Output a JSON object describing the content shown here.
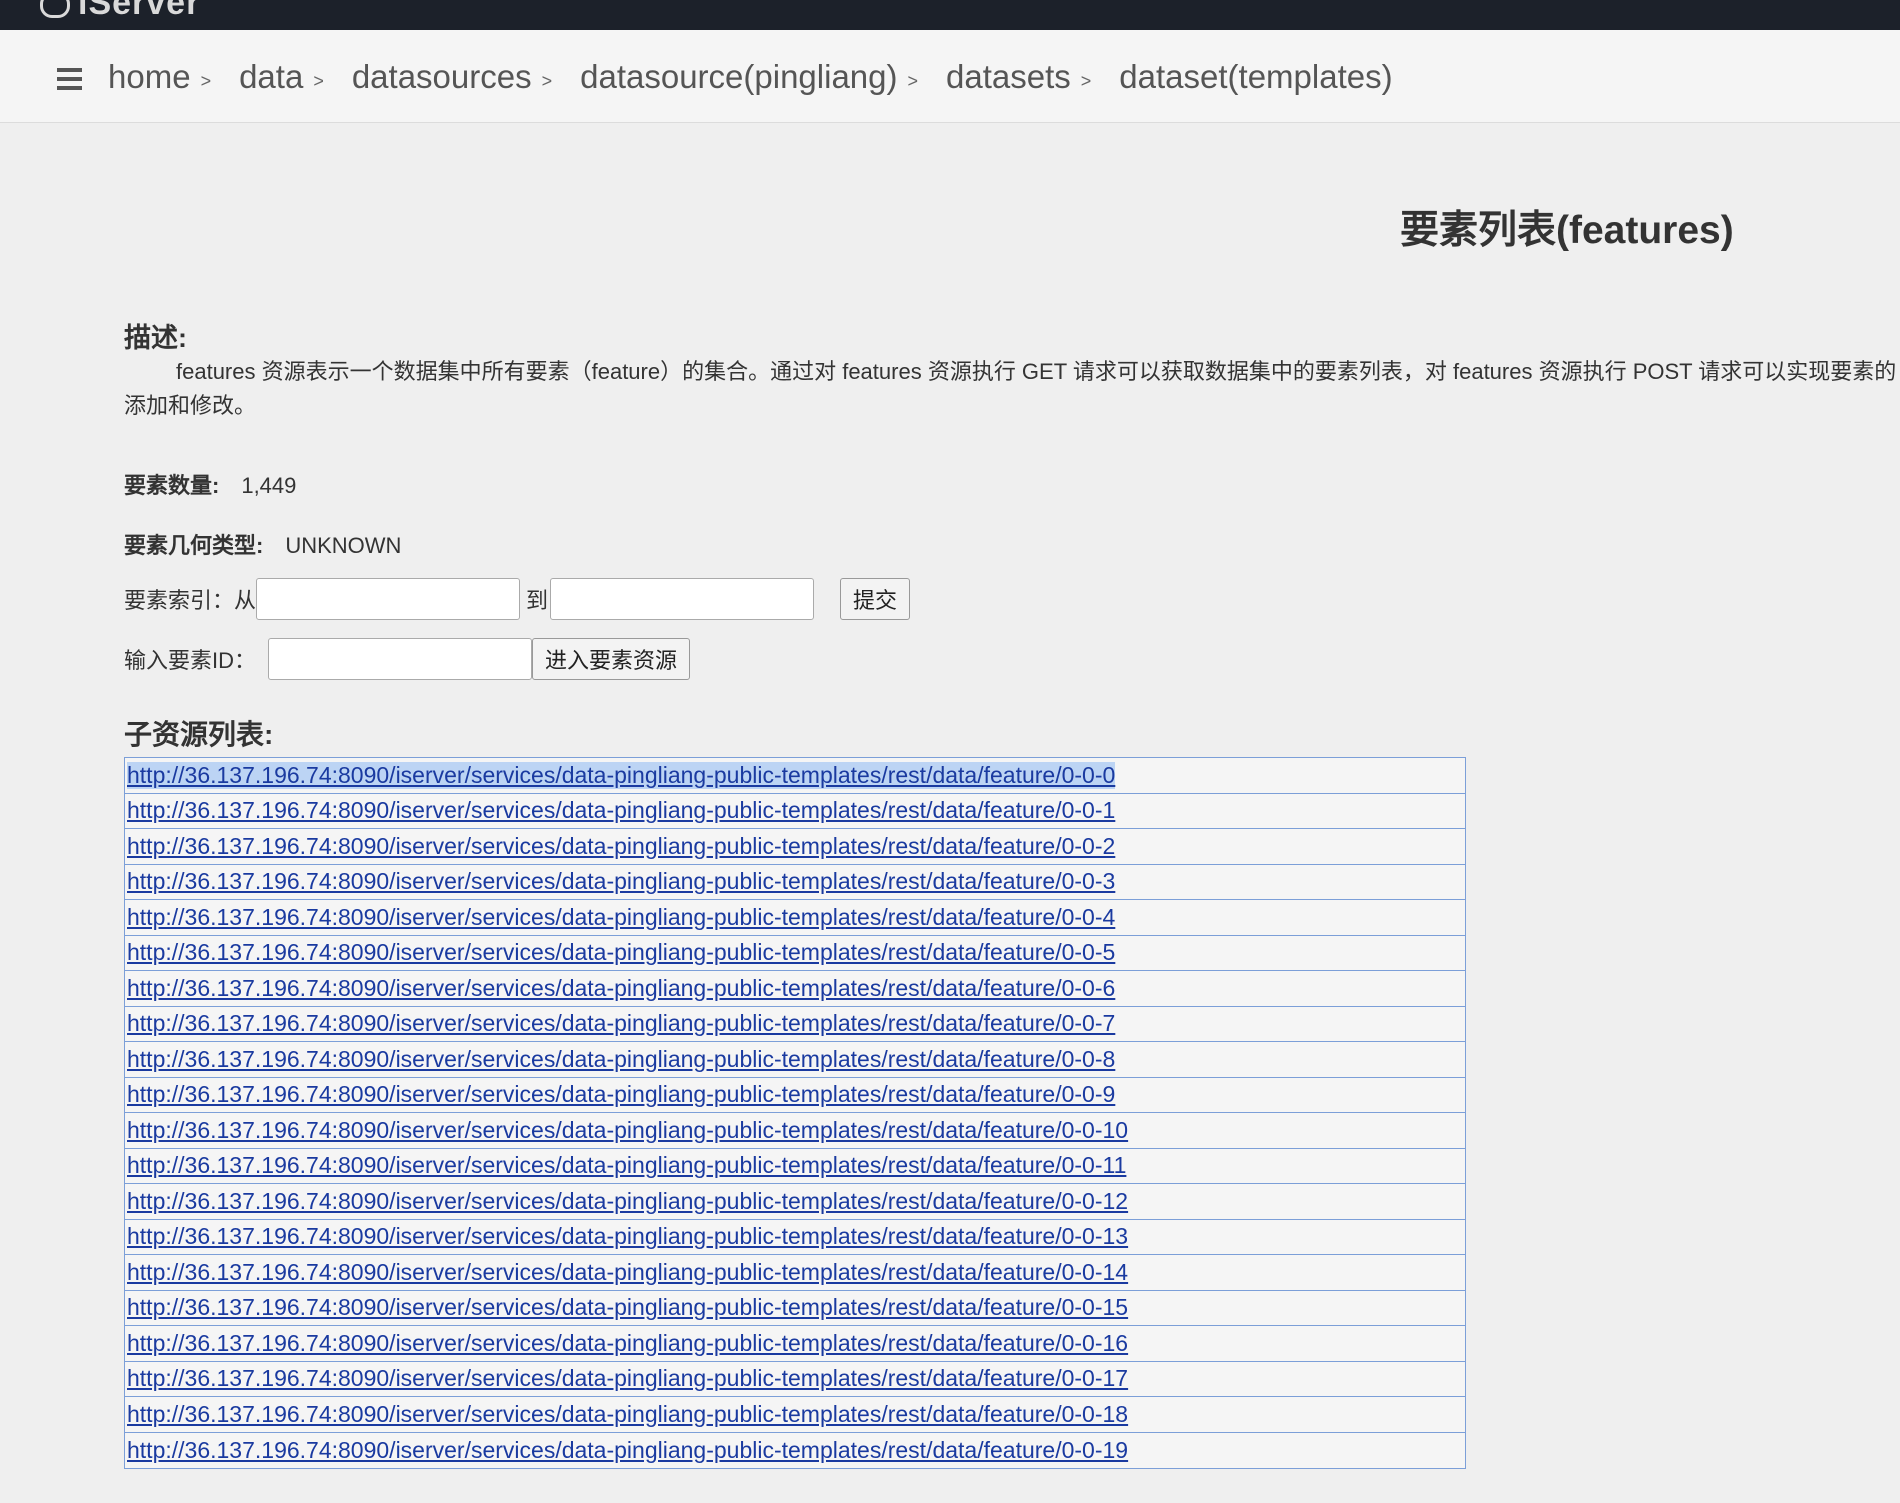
{
  "header": {
    "logo_text": "iServer"
  },
  "breadcrumb": [
    {
      "label": "home"
    },
    {
      "label": "data"
    },
    {
      "label": "datasources"
    },
    {
      "label": "datasource(pingliang)"
    },
    {
      "label": "datasets"
    },
    {
      "label": "dataset(templates)"
    }
  ],
  "breadcrumb_separator": ">",
  "page": {
    "title": "要素列表(features)",
    "description_label": "描述:",
    "description": "features 资源表示一个数据集中所有要素（feature）的集合。通过对 features 资源执行 GET 请求可以获取数据集中的要素列表，对 features 资源执行 POST 请求可以实现要素的添加和修改。",
    "feature_count_label": "要素数量:",
    "feature_count": "1,449",
    "geometry_type_label": "要素几何类型:",
    "geometry_type": "UNKNOWN",
    "index_label": "要素索引：从",
    "index_to_label": "到",
    "submit_button": "提交",
    "id_label": "输入要素ID：",
    "enter_button": "进入要素资源",
    "child_list_label": "子资源列表:"
  },
  "child_resources": [
    "http://36.137.196.74:8090/iserver/services/data-pingliang-public-templates/rest/data/feature/0-0-0",
    "http://36.137.196.74:8090/iserver/services/data-pingliang-public-templates/rest/data/feature/0-0-1",
    "http://36.137.196.74:8090/iserver/services/data-pingliang-public-templates/rest/data/feature/0-0-2",
    "http://36.137.196.74:8090/iserver/services/data-pingliang-public-templates/rest/data/feature/0-0-3",
    "http://36.137.196.74:8090/iserver/services/data-pingliang-public-templates/rest/data/feature/0-0-4",
    "http://36.137.196.74:8090/iserver/services/data-pingliang-public-templates/rest/data/feature/0-0-5",
    "http://36.137.196.74:8090/iserver/services/data-pingliang-public-templates/rest/data/feature/0-0-6",
    "http://36.137.196.74:8090/iserver/services/data-pingliang-public-templates/rest/data/feature/0-0-7",
    "http://36.137.196.74:8090/iserver/services/data-pingliang-public-templates/rest/data/feature/0-0-8",
    "http://36.137.196.74:8090/iserver/services/data-pingliang-public-templates/rest/data/feature/0-0-9",
    "http://36.137.196.74:8090/iserver/services/data-pingliang-public-templates/rest/data/feature/0-0-10",
    "http://36.137.196.74:8090/iserver/services/data-pingliang-public-templates/rest/data/feature/0-0-11",
    "http://36.137.196.74:8090/iserver/services/data-pingliang-public-templates/rest/data/feature/0-0-12",
    "http://36.137.196.74:8090/iserver/services/data-pingliang-public-templates/rest/data/feature/0-0-13",
    "http://36.137.196.74:8090/iserver/services/data-pingliang-public-templates/rest/data/feature/0-0-14",
    "http://36.137.196.74:8090/iserver/services/data-pingliang-public-templates/rest/data/feature/0-0-15",
    "http://36.137.196.74:8090/iserver/services/data-pingliang-public-templates/rest/data/feature/0-0-16",
    "http://36.137.196.74:8090/iserver/services/data-pingliang-public-templates/rest/data/feature/0-0-17",
    "http://36.137.196.74:8090/iserver/services/data-pingliang-public-templates/rest/data/feature/0-0-18",
    "http://36.137.196.74:8090/iserver/services/data-pingliang-public-templates/rest/data/feature/0-0-19"
  ],
  "selected_child_index": 0,
  "colors": {
    "topbar": "#1c212a",
    "link": "#1a3aa0",
    "list_border": "#7c9fd8",
    "selection": "#bcd4f4"
  }
}
